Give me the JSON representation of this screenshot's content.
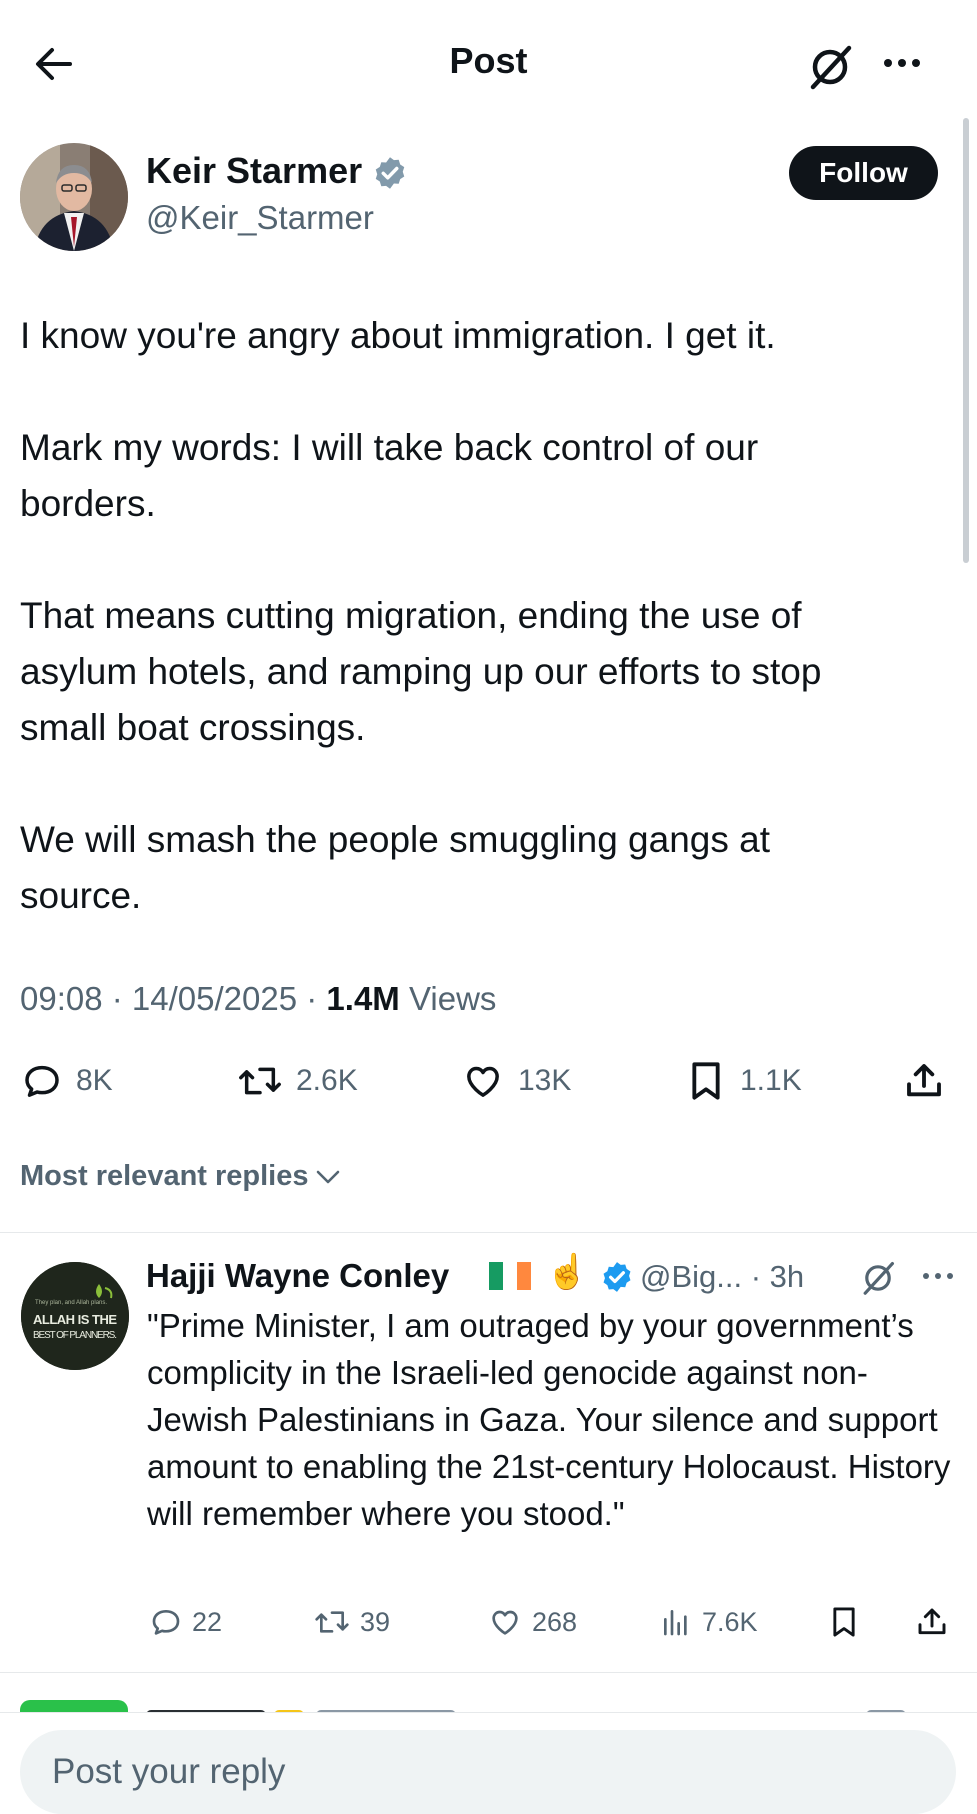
{
  "header": {
    "title": "Post",
    "back_icon": "arrow-left-icon",
    "grok_icon": "grok-icon",
    "more_icon": "more-horizontal-icon"
  },
  "post": {
    "author": {
      "name": "Keir Starmer",
      "handle": "@Keir_Starmer",
      "verified": true,
      "verified_color": "#829aab"
    },
    "follow_label": "Follow",
    "paragraphs": [
      "I know you're angry about immigration. I get it.",
      "Mark my words: I will take back control of our\nborders.",
      "That means cutting migration, ending the use of\nasylum hotels, and ramping up our efforts to stop\nsmall boat crossings.",
      "We will smash the people smuggling gangs at\nsource."
    ],
    "time": "09:08",
    "date": "14/05/2025",
    "views_count": "1.4M",
    "views_label": "Views",
    "stats": {
      "replies": "8K",
      "reposts": "2.6K",
      "likes": "13K",
      "bookmarks": "1.1K"
    }
  },
  "replies_filter": {
    "label": "Most relevant replies"
  },
  "reply": {
    "name": "Hajji Wayne Conley",
    "emoji": "☝️",
    "verified_color": "#1d9bf0",
    "handle": "@Big...",
    "time": "· 3h",
    "avatar_text_small": "They plan, and Allah plans.",
    "avatar_text_big1": "ALLAH IS THE",
    "avatar_text_big2": "BEST OF PLANNERS.",
    "text": "\"Prime Minister, I am outraged by your government’s complicity in the Israeli-led genocide against non-Jewish Palestinians in Gaza. Your silence and support amount to enabling the 21st-century Holocaust. History will remember where you stood.\"",
    "stats": {
      "replies": "22",
      "reposts": "39",
      "likes": "268",
      "views": "7.6K"
    }
  },
  "composer": {
    "placeholder": "Post your reply"
  },
  "colors": {
    "text": "#0f1419",
    "secondary": "#536471",
    "divider": "#e6e9eb",
    "link_blue": "#1d9bf0"
  }
}
